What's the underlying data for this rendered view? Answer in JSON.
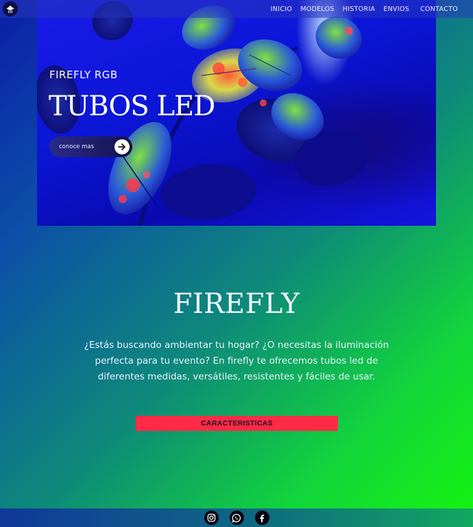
{
  "nav": {
    "items": [
      {
        "label": "INICIO"
      },
      {
        "label": "MODELOS"
      },
      {
        "label": "HISTORIA"
      },
      {
        "label": "ENVIOS"
      },
      {
        "label": "CONTACTO"
      }
    ]
  },
  "hero": {
    "subtitle": "FIREFLY RGB",
    "title": "TUBOS LED",
    "cta_label": "conoce mas",
    "cta_icon": "arrow-right-icon"
  },
  "main": {
    "title": "FIREFLY",
    "description": "¿Estás buscando ambientar tu hogar? ¿O necesitas la iluminación perfecta para tu evento? En firefly te ofrecemos tubos led de diferentes medidas, versátiles, resistentes y fáciles de usar.",
    "button_label": "CARACTERISTICAS"
  },
  "footer": {
    "icons": [
      "instagram-icon",
      "whatsapp-icon",
      "facebook-icon"
    ]
  },
  "colors": {
    "accent_button": "#ff2a45",
    "hero_blue": "#1515e0",
    "gradient_end": "#15f50f"
  }
}
